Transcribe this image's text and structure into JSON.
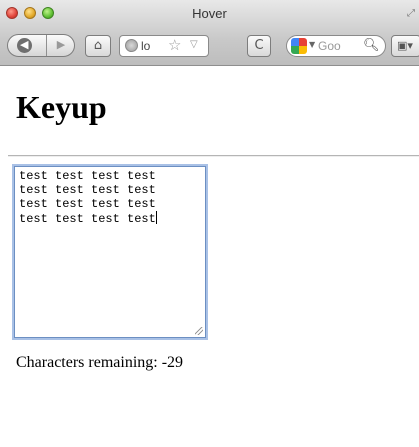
{
  "window": {
    "title": "Hover",
    "traffic_lights": [
      "close",
      "minimize",
      "zoom"
    ]
  },
  "toolbar": {
    "back_icon": "back-arrow-icon",
    "forward_icon": "forward-arrow-icon",
    "home_icon": "home-icon",
    "url_text": "lo",
    "reload_label": "C",
    "search_text": "Goo",
    "search_icon": "magnifier-icon",
    "extension_icon": "bookmark-dropdown-icon"
  },
  "page": {
    "heading": "Keyup",
    "textarea_value": "test test test test\ntest test test test\ntest test test test\ntest test test test",
    "remaining_text": "Characters remaining: -29"
  },
  "colors": {
    "focus_ring": "#a9c1e6",
    "titlebar_top": "#e8e8e8",
    "titlebar_bottom": "#bdbdbd"
  }
}
